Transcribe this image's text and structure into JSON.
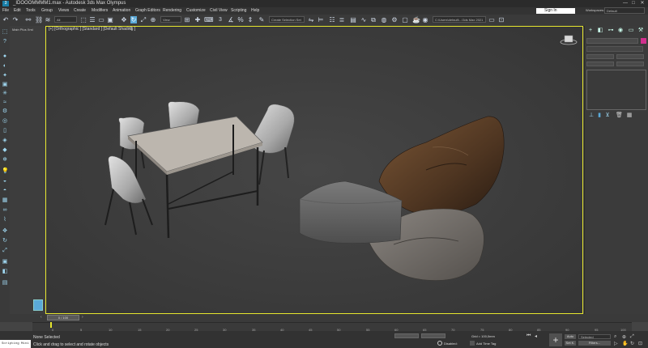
{
  "window": {
    "title": "_IDOOOMMMM1.max - Autodesk 3ds Max Olympus",
    "controls": [
      "—",
      "□",
      "✕"
    ],
    "sign_in": "Sign In",
    "workspaces_label": "Workspaces:",
    "workspace_value": "Default"
  },
  "menu": [
    "File",
    "Edit",
    "Tools",
    "Group",
    "Views",
    "Create",
    "Modifiers",
    "Animation",
    "Graph Editors",
    "Rendering",
    "Customize",
    "Civil View",
    "Scripting",
    "Help"
  ],
  "toolbar": {
    "selection_filter": "All",
    "view_dropdown": "View",
    "selection_set": "Create Selection Set",
    "project_path": "C:\\Users\\default\\...\\3ds Max 2021"
  },
  "scene_explorer": {
    "label": "Main Plus Xrst"
  },
  "viewport": {
    "label": "[+] [Orthographic ] [Standard ] [Default Shading ]"
  },
  "timeline": {
    "frame": "0 / 100",
    "ticks": [
      "0",
      "5",
      "10",
      "15",
      "20",
      "25",
      "30",
      "35",
      "40",
      "45",
      "50",
      "55",
      "60",
      "65",
      "70",
      "75",
      "80",
      "85",
      "90",
      "95",
      "100"
    ]
  },
  "status": {
    "selection": "None Selected",
    "prompt": "Click and drag to select and rotate objects",
    "maxscript": "Scripting Mini",
    "disabled": "Disabled:",
    "add_time_tag": "Add Time Tag",
    "grid": "Grid = 100,0mm",
    "auto": "Auto",
    "selected": "Selected",
    "set_k": "Set K.",
    "filters": "Filters..."
  },
  "colors": {
    "accent_blue": "#5aa9d8",
    "active_frame_yellow": "#e6e62e",
    "magenta_swatch": "#d0308d"
  }
}
